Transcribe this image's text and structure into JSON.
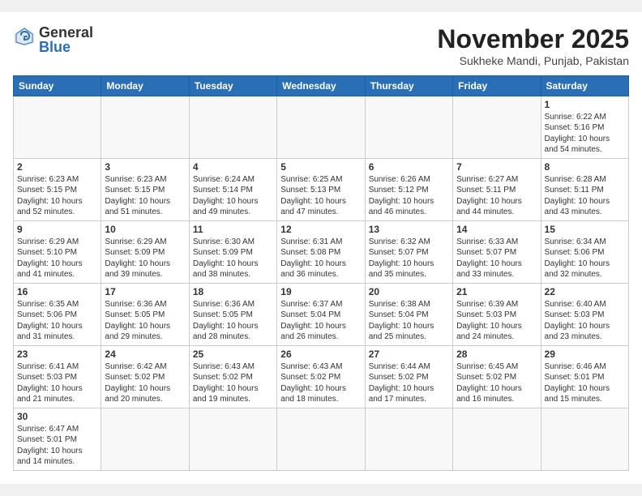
{
  "header": {
    "logo_general": "General",
    "logo_blue": "Blue",
    "month_year": "November 2025",
    "location": "Sukheke Mandi, Punjab, Pakistan"
  },
  "weekdays": [
    "Sunday",
    "Monday",
    "Tuesday",
    "Wednesday",
    "Thursday",
    "Friday",
    "Saturday"
  ],
  "weeks": [
    [
      {
        "day": "",
        "content": ""
      },
      {
        "day": "",
        "content": ""
      },
      {
        "day": "",
        "content": ""
      },
      {
        "day": "",
        "content": ""
      },
      {
        "day": "",
        "content": ""
      },
      {
        "day": "",
        "content": ""
      },
      {
        "day": "1",
        "content": "Sunrise: 6:22 AM\nSunset: 5:16 PM\nDaylight: 10 hours\nand 54 minutes."
      }
    ],
    [
      {
        "day": "2",
        "content": "Sunrise: 6:23 AM\nSunset: 5:15 PM\nDaylight: 10 hours\nand 52 minutes."
      },
      {
        "day": "3",
        "content": "Sunrise: 6:23 AM\nSunset: 5:15 PM\nDaylight: 10 hours\nand 51 minutes."
      },
      {
        "day": "4",
        "content": "Sunrise: 6:24 AM\nSunset: 5:14 PM\nDaylight: 10 hours\nand 49 minutes."
      },
      {
        "day": "5",
        "content": "Sunrise: 6:25 AM\nSunset: 5:13 PM\nDaylight: 10 hours\nand 47 minutes."
      },
      {
        "day": "6",
        "content": "Sunrise: 6:26 AM\nSunset: 5:12 PM\nDaylight: 10 hours\nand 46 minutes."
      },
      {
        "day": "7",
        "content": "Sunrise: 6:27 AM\nSunset: 5:11 PM\nDaylight: 10 hours\nand 44 minutes."
      },
      {
        "day": "8",
        "content": "Sunrise: 6:28 AM\nSunset: 5:11 PM\nDaylight: 10 hours\nand 43 minutes."
      }
    ],
    [
      {
        "day": "9",
        "content": "Sunrise: 6:29 AM\nSunset: 5:10 PM\nDaylight: 10 hours\nand 41 minutes."
      },
      {
        "day": "10",
        "content": "Sunrise: 6:29 AM\nSunset: 5:09 PM\nDaylight: 10 hours\nand 39 minutes."
      },
      {
        "day": "11",
        "content": "Sunrise: 6:30 AM\nSunset: 5:09 PM\nDaylight: 10 hours\nand 38 minutes."
      },
      {
        "day": "12",
        "content": "Sunrise: 6:31 AM\nSunset: 5:08 PM\nDaylight: 10 hours\nand 36 minutes."
      },
      {
        "day": "13",
        "content": "Sunrise: 6:32 AM\nSunset: 5:07 PM\nDaylight: 10 hours\nand 35 minutes."
      },
      {
        "day": "14",
        "content": "Sunrise: 6:33 AM\nSunset: 5:07 PM\nDaylight: 10 hours\nand 33 minutes."
      },
      {
        "day": "15",
        "content": "Sunrise: 6:34 AM\nSunset: 5:06 PM\nDaylight: 10 hours\nand 32 minutes."
      }
    ],
    [
      {
        "day": "16",
        "content": "Sunrise: 6:35 AM\nSunset: 5:06 PM\nDaylight: 10 hours\nand 31 minutes."
      },
      {
        "day": "17",
        "content": "Sunrise: 6:36 AM\nSunset: 5:05 PM\nDaylight: 10 hours\nand 29 minutes."
      },
      {
        "day": "18",
        "content": "Sunrise: 6:36 AM\nSunset: 5:05 PM\nDaylight: 10 hours\nand 28 minutes."
      },
      {
        "day": "19",
        "content": "Sunrise: 6:37 AM\nSunset: 5:04 PM\nDaylight: 10 hours\nand 26 minutes."
      },
      {
        "day": "20",
        "content": "Sunrise: 6:38 AM\nSunset: 5:04 PM\nDaylight: 10 hours\nand 25 minutes."
      },
      {
        "day": "21",
        "content": "Sunrise: 6:39 AM\nSunset: 5:03 PM\nDaylight: 10 hours\nand 24 minutes."
      },
      {
        "day": "22",
        "content": "Sunrise: 6:40 AM\nSunset: 5:03 PM\nDaylight: 10 hours\nand 23 minutes."
      }
    ],
    [
      {
        "day": "23",
        "content": "Sunrise: 6:41 AM\nSunset: 5:03 PM\nDaylight: 10 hours\nand 21 minutes."
      },
      {
        "day": "24",
        "content": "Sunrise: 6:42 AM\nSunset: 5:02 PM\nDaylight: 10 hours\nand 20 minutes."
      },
      {
        "day": "25",
        "content": "Sunrise: 6:43 AM\nSunset: 5:02 PM\nDaylight: 10 hours\nand 19 minutes."
      },
      {
        "day": "26",
        "content": "Sunrise: 6:43 AM\nSunset: 5:02 PM\nDaylight: 10 hours\nand 18 minutes."
      },
      {
        "day": "27",
        "content": "Sunrise: 6:44 AM\nSunset: 5:02 PM\nDaylight: 10 hours\nand 17 minutes."
      },
      {
        "day": "28",
        "content": "Sunrise: 6:45 AM\nSunset: 5:02 PM\nDaylight: 10 hours\nand 16 minutes."
      },
      {
        "day": "29",
        "content": "Sunrise: 6:46 AM\nSunset: 5:01 PM\nDaylight: 10 hours\nand 15 minutes."
      }
    ],
    [
      {
        "day": "30",
        "content": "Sunrise: 6:47 AM\nSunset: 5:01 PM\nDaylight: 10 hours\nand 14 minutes."
      },
      {
        "day": "",
        "content": ""
      },
      {
        "day": "",
        "content": ""
      },
      {
        "day": "",
        "content": ""
      },
      {
        "day": "",
        "content": ""
      },
      {
        "day": "",
        "content": ""
      },
      {
        "day": "",
        "content": ""
      }
    ]
  ]
}
